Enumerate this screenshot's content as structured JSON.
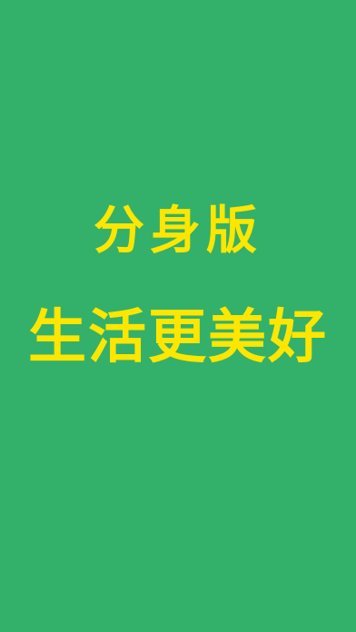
{
  "colors": {
    "background": "#33B16A",
    "text": "#FFE600"
  },
  "splash": {
    "line1": "分身版",
    "line2": "生活更美好"
  }
}
